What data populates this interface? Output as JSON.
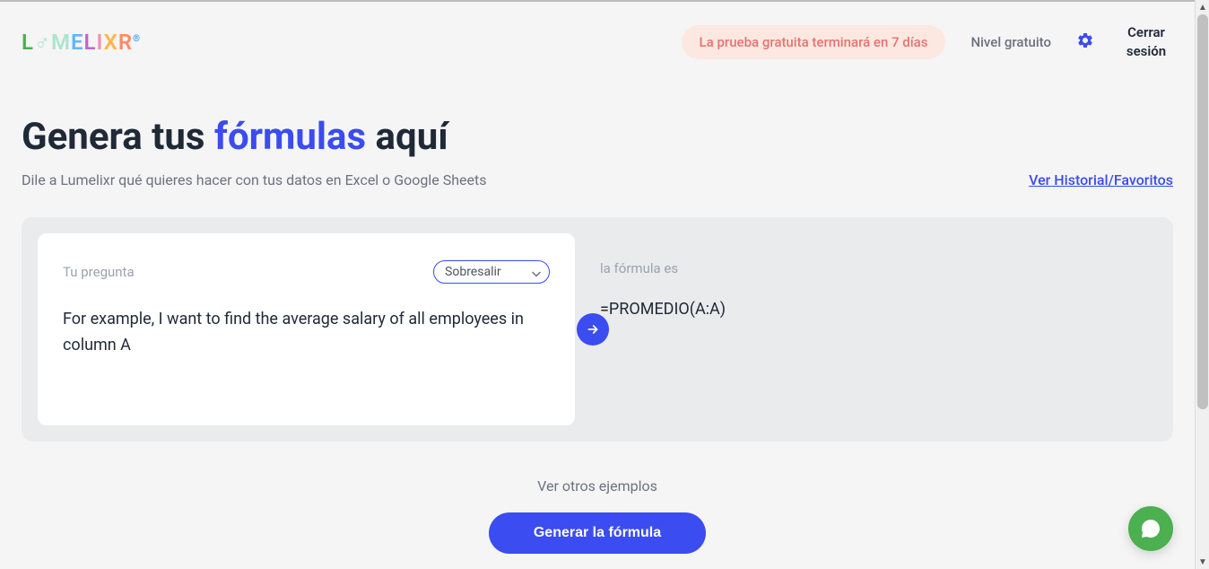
{
  "header": {
    "trial_badge": "La prueba gratuita terminará en 7 días",
    "tier_label": "Nivel gratuito",
    "logout": "Cerrar sesión"
  },
  "main": {
    "title_part1": "Genera tus ",
    "title_highlight": "fórmulas",
    "title_part2": " aquí",
    "subtitle": "Dile a Lumelixr qué quieres hacer con tus datos en Excel o Google Sheets",
    "history_link": "Ver Historial/Favoritos"
  },
  "panel": {
    "question_label": "Tu pregunta",
    "platform_selected": "Sobresalir",
    "question_text": "For example, I want to find the average salary of all employees in column A",
    "formula_label": "la fórmula es",
    "formula_text": "=PROMEDIO(A:A)"
  },
  "footer": {
    "other_examples": "Ver otros ejemplos",
    "generate_button": "Generar la fórmula"
  }
}
